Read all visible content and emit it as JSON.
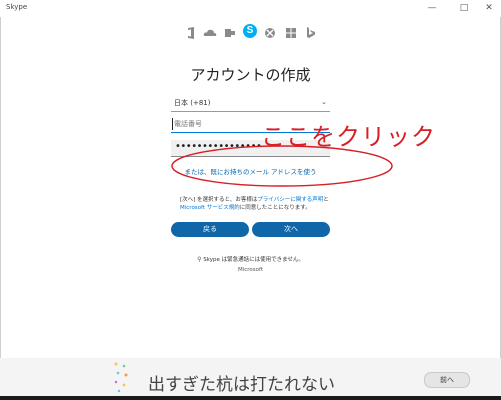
{
  "window": {
    "title": "Skype",
    "minimize": "—",
    "maximize": "□",
    "close": "✕"
  },
  "heading": "アカウントの作成",
  "country": {
    "value": "日本 (+81)",
    "chevron": "⌄"
  },
  "phone": {
    "placeholder": "電話番号"
  },
  "password": {
    "dots": "••••••••••••••••"
  },
  "email_link": "または、既にお持ちのメール アドレスを使う",
  "terms": {
    "line1_a": "[次へ] を選択すると、お客様は",
    "privacy_link": "プライバシーに関する声明",
    "line1_b": "と",
    "line2_link": "Microsoft サービス規約",
    "line2_b": "に同意したことになります。"
  },
  "buttons": {
    "back": "戻る",
    "next": "次へ"
  },
  "note": "Skype は緊急通話には使用できません。",
  "microsoft": "Microsoft",
  "annotation": "ここをクリック",
  "bottom": {
    "proverb": "出すぎた杭は打たれない",
    "next": "前へ"
  },
  "icons": [
    "office-icon",
    "onedrive-icon",
    "outlook-icon",
    "skype-icon",
    "xbox-icon",
    "windows-icon",
    "bing-icon"
  ],
  "colors": {
    "accent": "#0f66a8",
    "skype": "#00aff0",
    "annotation": "#d81f26"
  }
}
